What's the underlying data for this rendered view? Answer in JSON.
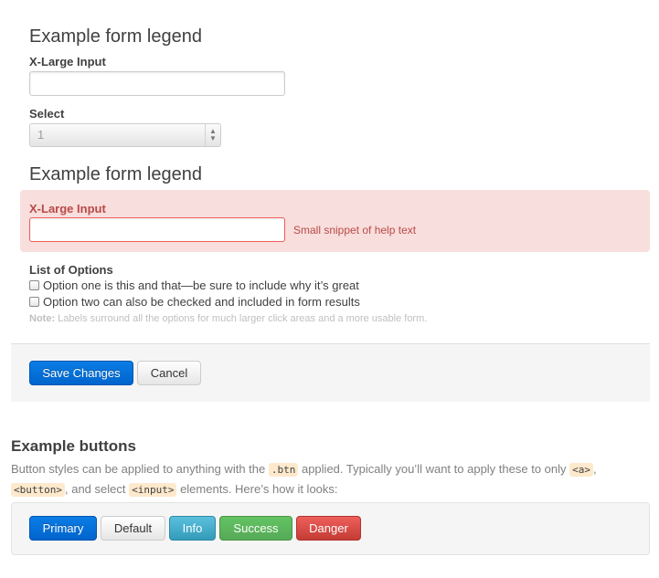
{
  "form1": {
    "legend": "Example form legend",
    "xlarge_label": "X-Large Input",
    "xlarge_value": "",
    "select_label": "Select",
    "select_value": "1"
  },
  "form2": {
    "legend": "Example form legend",
    "error_label": "X-Large Input",
    "error_value": "",
    "help_text": "Small snippet of help text",
    "options_label": "List of Options",
    "option1": "Option one is this and that—be sure to include why it’s great",
    "option2": "Option two can also be checked and included in form results",
    "note_bold": "Note:",
    "note_text": " Labels surround all the options for much larger click areas and a more usable form."
  },
  "actions": {
    "save": "Save Changes",
    "cancel": "Cancel"
  },
  "buttons_section": {
    "title": "Example buttons",
    "p1": "Button styles can be applied to anything with the ",
    "code_btn": ".btn",
    "p2": " applied. Typically you’ll want to apply these to only ",
    "code_a": "<a>",
    "p3": ",",
    "code_button": "<button>",
    "p4": ", and select ",
    "code_input": "<input>",
    "p5": " elements. Here’s how it looks:",
    "buttons": {
      "primary": "Primary",
      "default": "Default",
      "info": "Info",
      "success": "Success",
      "danger": "Danger"
    }
  },
  "colors": {
    "primary": "#0064cd",
    "info": "#5bc0de",
    "success": "#57a957",
    "danger": "#c43c35",
    "error_bg": "#f8dedc",
    "error_text": "#b94a48"
  }
}
